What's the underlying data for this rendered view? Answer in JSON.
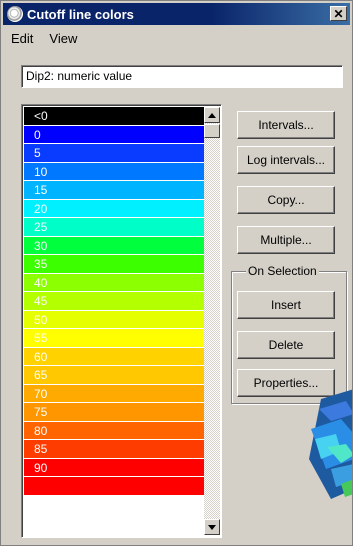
{
  "window": {
    "title": "Cutoff line colors",
    "close_label": "✕"
  },
  "menu": {
    "items": [
      "Edit",
      "View"
    ]
  },
  "field": {
    "value": "Dip2: numeric value"
  },
  "colors": {
    "rows": [
      {
        "label": "<0",
        "color": "#000000",
        "text": "#ffffff"
      },
      {
        "label": "0",
        "color": "#0000ff",
        "text": "#ffffff"
      },
      {
        "label": "5",
        "color": "#0a3cff",
        "text": "#ffffff"
      },
      {
        "label": "10",
        "color": "#0078ff",
        "text": "#ffffff"
      },
      {
        "label": "15",
        "color": "#00b4ff",
        "text": "#ffffff"
      },
      {
        "label": "20",
        "color": "#00f0ff",
        "text": "#ffffff"
      },
      {
        "label": "25",
        "color": "#00ffc8",
        "text": "#ffffff"
      },
      {
        "label": "30",
        "color": "#00ff3c",
        "text": "#ffffff"
      },
      {
        "label": "35",
        "color": "#3cff00",
        "text": "#ffffff"
      },
      {
        "label": "40",
        "color": "#8cff00",
        "text": "#ffffff"
      },
      {
        "label": "45",
        "color": "#b4ff00",
        "text": "#ffffff"
      },
      {
        "label": "50",
        "color": "#e6ff00",
        "text": "#ffffff"
      },
      {
        "label": "55",
        "color": "#ffff00",
        "text": "#ffffff"
      },
      {
        "label": "60",
        "color": "#ffd200",
        "text": "#ffffff"
      },
      {
        "label": "65",
        "color": "#ffc800",
        "text": "#ffffff"
      },
      {
        "label": "70",
        "color": "#ffaa00",
        "text": "#ffffff"
      },
      {
        "label": "75",
        "color": "#ff9600",
        "text": "#ffffff"
      },
      {
        "label": "80",
        "color": "#ff6400",
        "text": "#ffffff"
      },
      {
        "label": "85",
        "color": "#ff3c00",
        "text": "#ffffff"
      },
      {
        "label": "90",
        "color": "#ff0000",
        "text": "#ffffff"
      },
      {
        "label": "",
        "color": "#ff0000",
        "text": "#ffffff"
      },
      {
        "label": "",
        "color": "#ffffff",
        "text": "#000000"
      }
    ]
  },
  "buttons": {
    "intervals": "Intervals...",
    "log_intervals": "Log intervals...",
    "copy": "Copy...",
    "multiple": "Multiple..."
  },
  "selection": {
    "group_label": "On Selection",
    "insert": "Insert",
    "delete": "Delete",
    "properties": "Properties..."
  },
  "icons": {
    "app": "globe-icon",
    "scroll_up": "arrow-up-icon",
    "scroll_down": "arrow-down-icon"
  }
}
